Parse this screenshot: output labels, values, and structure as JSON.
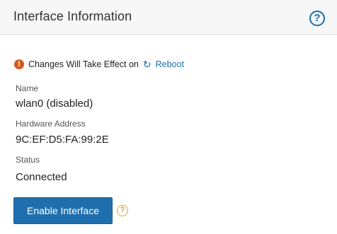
{
  "header": {
    "title": "Interface Information",
    "help_icon": "question-circle-icon"
  },
  "notice": {
    "icon": "exclamation-circle-icon",
    "text": "Changes Will Take Effect on",
    "reboot_icon": "refresh-icon",
    "reboot_label": "Reboot"
  },
  "fields": {
    "name_label": "Name",
    "name_value": "wlan0 (disabled)",
    "hw_label": "Hardware Address",
    "hw_value": "9C:EF:D5:FA:99:2E",
    "status_label": "Status",
    "status_value": "Connected"
  },
  "actions": {
    "enable_label": "Enable Interface",
    "hint_icon": "question-circle-icon"
  },
  "colors": {
    "accent": "#1f6fae",
    "warning": "#d35a1c",
    "hint": "#e2a325"
  }
}
